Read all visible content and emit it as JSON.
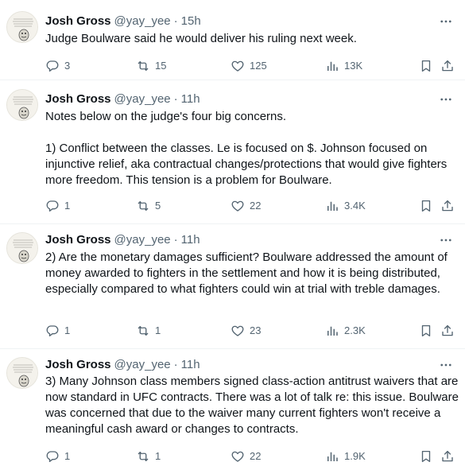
{
  "tweets": [
    {
      "name": "Josh Gross",
      "handle": "@yay_yee",
      "separator": "·",
      "time": "15h",
      "text": "Judge Boulware said he would deliver his ruling next week.",
      "replies": "3",
      "reposts": "15",
      "likes": "125",
      "views": "13K"
    },
    {
      "name": "Josh Gross",
      "handle": "@yay_yee",
      "separator": "·",
      "time": "11h",
      "text": "Notes below on the judge's four big concerns.\n\n1) Conflict between the classes. Le is focused on $. Johnson focused on injunctive relief, aka contractual changes/protections that would give fighters more freedom. This tension is a problem for Boulware.",
      "replies": "1",
      "reposts": "5",
      "likes": "22",
      "views": "3.4K"
    },
    {
      "name": "Josh Gross",
      "handle": "@yay_yee",
      "separator": "·",
      "time": "11h",
      "text": "2) Are the monetary damages sufficient? Boulware addressed the amount of money awarded to fighters in the settlement and how it is being distributed, especially compared to what fighters could win at trial with treble damages.",
      "replies": "1",
      "reposts": "1",
      "likes": "23",
      "views": "2.3K"
    },
    {
      "name": "Josh Gross",
      "handle": "@yay_yee",
      "separator": "·",
      "time": "11h",
      "text": "3) Many Johnson class members signed class-action antitrust waivers that are now standard in UFC contracts. There was a lot of talk re: this issue. Boulware was concerned that due to the waiver many current fighters won't receive a meaningful cash award or changes to contracts.",
      "replies": "1",
      "reposts": "1",
      "likes": "22",
      "views": "1.9K"
    }
  ],
  "icons": {
    "avatar": "avatar-icon",
    "more": "more-icon",
    "reply": "reply-icon",
    "repost": "repost-icon",
    "like": "like-icon",
    "views": "views-icon",
    "bookmark": "bookmark-icon",
    "share": "share-icon"
  },
  "colors": {
    "text": "#0f1419",
    "secondary": "#536471",
    "divider": "#eff3f4"
  }
}
